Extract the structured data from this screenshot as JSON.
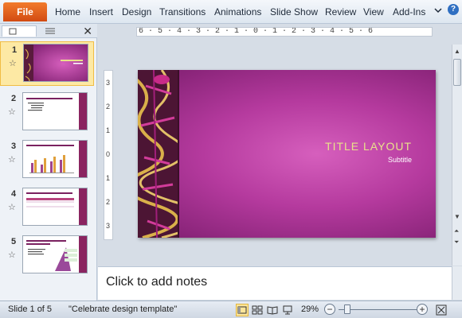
{
  "ribbon": {
    "file_label": "File",
    "tabs": [
      "Home",
      "Insert",
      "Design",
      "Transitions",
      "Animations",
      "Slide Show",
      "Review",
      "View",
      "Add-Ins"
    ],
    "help_icon": "question-icon",
    "minimize_icon": "chevron-icon"
  },
  "slides_panel": {
    "slides": [
      {
        "number": "1",
        "selected": true
      },
      {
        "number": "2",
        "selected": false
      },
      {
        "number": "3",
        "selected": false
      },
      {
        "number": "4",
        "selected": false
      },
      {
        "number": "5",
        "selected": false
      }
    ]
  },
  "ruler": {
    "horizontal": "6 · 5 · 4 · 3 · 2 · 1 · 0 · 1 · 2 · 3 · 4 · 5 · 6",
    "vertical": [
      "3",
      "2",
      "1",
      "0",
      "1",
      "2",
      "3"
    ]
  },
  "slide": {
    "title": "TITLE LAYOUT",
    "subtitle": "Subtitle"
  },
  "notes": {
    "placeholder": "Click to add notes"
  },
  "status": {
    "slide_info": "Slide 1 of 5",
    "theme": "\"Celebrate design template\"",
    "zoom": "29%"
  },
  "colors": {
    "file_tab": "#e0601c",
    "slide_magenta": "#b53a9e",
    "title_color": "#e9e28a"
  }
}
